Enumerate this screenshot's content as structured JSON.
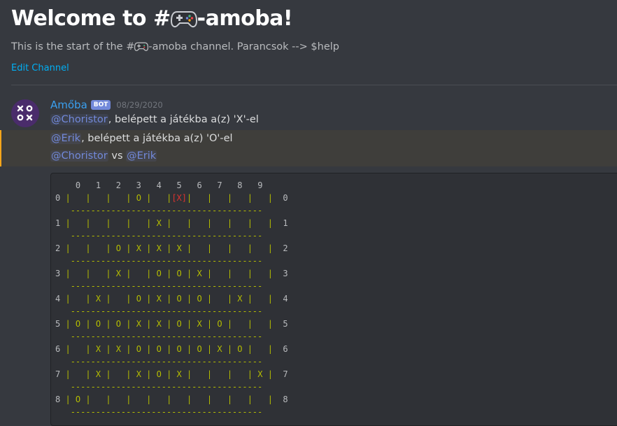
{
  "welcome": {
    "title_prefix": "Welcome to #",
    "title_suffix": "-amoba!",
    "intro_prefix": "This is the start of the #",
    "intro_suffix": "-amoba channel. Parancsok --> $help",
    "edit_label": "Edit Channel"
  },
  "message": {
    "username": "Amőba",
    "bot_tag": "BOT",
    "timestamp": "08/29/2020",
    "line1": {
      "mention": "@Choristor",
      "text": ", belépett a játékba a(z) 'X'-el"
    },
    "line2": {
      "mention": "@Erik",
      "text": ", belépett a játékba a(z) 'O'-el"
    },
    "line3": {
      "mention1": "@Choristor",
      "vs": " vs ",
      "mention2": "@Erik"
    }
  },
  "board": {
    "col_header": [
      "0",
      "1",
      "2",
      "3",
      "4",
      "5",
      "6",
      "7",
      "8",
      "9"
    ],
    "row_labels": [
      "0",
      "1",
      "2",
      "3",
      "4",
      "5",
      "6",
      "7",
      "8"
    ],
    "separator": "--------------------------------------",
    "rows": [
      [
        "",
        "",
        "",
        "O",
        "",
        "X",
        "",
        "",
        "",
        ""
      ],
      [
        "",
        "",
        "",
        "",
        "X",
        "",
        "",
        "",
        "",
        ""
      ],
      [
        "",
        "",
        "O",
        "X",
        "X",
        "X",
        "",
        "",
        "",
        ""
      ],
      [
        "",
        "",
        "X",
        "",
        "O",
        "O",
        "X",
        "",
        "",
        ""
      ],
      [
        "",
        "X",
        "",
        "O",
        "X",
        "O",
        "O",
        "",
        "X",
        ""
      ],
      [
        "O",
        "O",
        "O",
        "X",
        "X",
        "O",
        "X",
        "O",
        "",
        ""
      ],
      [
        "",
        "X",
        "X",
        "O",
        "O",
        "O",
        "O",
        "X",
        "O",
        ""
      ],
      [
        "",
        "X",
        "",
        "X",
        "O",
        "X",
        "",
        "",
        "",
        "X"
      ],
      [
        "O",
        "",
        "",
        "",
        "",
        "",
        "",
        "",
        "",
        ""
      ]
    ],
    "last_move": {
      "row": 0,
      "col": 5
    }
  },
  "colors": {
    "background": "#36393f",
    "code_background": "#2f3136",
    "mention": "#7289da",
    "link": "#00aff4",
    "piece": "#b5bd00",
    "last_move": "#dc322f",
    "highlight_border": "#faa61a"
  },
  "icons": [
    "gamepad-icon",
    "amoba-avatar-icon"
  ]
}
